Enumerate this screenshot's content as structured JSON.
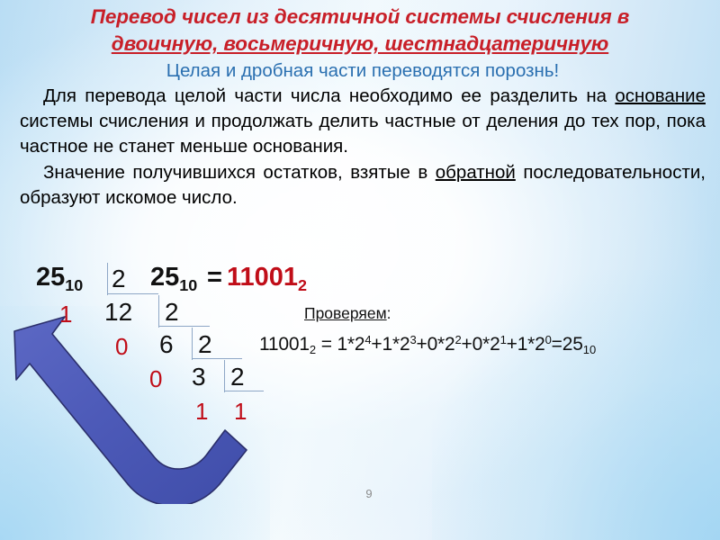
{
  "slide": {
    "page_number": "9",
    "colors": {
      "title_red": "#c81f28",
      "accent_blue": "#2a6fb0",
      "remainder_red": "#c00d18",
      "arrow_blue": "#4d5ab8",
      "arrow_outline": "#2b2f6b",
      "body_black": "#000000",
      "page_number_gray": "#8c8c8c"
    }
  },
  "title": {
    "line1": "Перевод чисел из десятичной системы счисления в",
    "line2": "двоичную, восьмеричную, шестнадцатеричную"
  },
  "body": {
    "intro": "Целая и дробная части переводятся порознь!",
    "p1_a": "Для перевода целой части числа необходимо ее разделить на ",
    "p1_underlined": "основание",
    "p1_b": " системы счисления и продолжать делить частные от деления до тех пор, пока частное не станет меньше основания.",
    "p2_a": "Значение получившихся остатков, взятые в ",
    "p2_underlined": "обратной",
    "p2_b": " последовательности, образуют искомое число."
  },
  "division": {
    "dividends": [
      "25",
      "12",
      "6",
      "3",
      "1"
    ],
    "dividend_subscript": "10",
    "divisors": [
      "2",
      "2",
      "2",
      "2"
    ],
    "remainders": [
      "1",
      "0",
      "0",
      "1"
    ],
    "last_quotient": "1"
  },
  "result": {
    "lhs_value": "25",
    "lhs_subscript": "10",
    "equals": "=",
    "rhs_value": "11001",
    "rhs_subscript": "2"
  },
  "check": {
    "label": "Проверяем",
    "label_colon": ":",
    "formula": {
      "number": "11001",
      "number_subscript": "2",
      "equals": " = ",
      "terms": [
        {
          "coefficient": "1*2",
          "exponent": "4"
        },
        {
          "coefficient": "1*2",
          "exponent": "3"
        },
        {
          "coefficient": "0*2",
          "exponent": "2"
        },
        {
          "coefficient": "0*2",
          "exponent": "1"
        },
        {
          "coefficient": "1*2",
          "exponent": "0"
        }
      ],
      "plus": "+",
      "result_equals": "=",
      "result": "25",
      "result_subscript": "10"
    }
  },
  "arrow": {
    "name": "read-remainders-upward-arrow"
  }
}
